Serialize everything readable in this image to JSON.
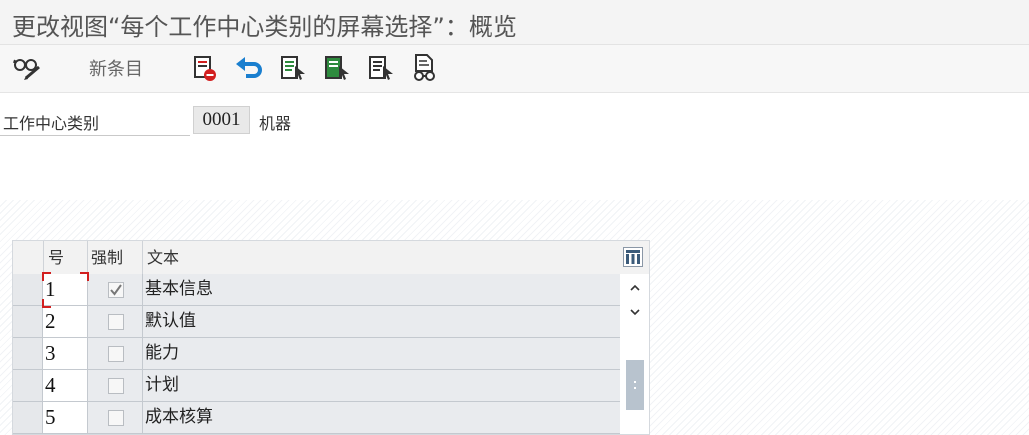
{
  "window": {
    "title": "更改视图“每个工作中心类别的屏幕选择”：概览"
  },
  "toolbar": {
    "display_change_icon": "glasses-pencil-icon",
    "new_entries_label": "新条目",
    "buttons": [
      {
        "name": "delete-row-button",
        "icon": "delete-row-icon"
      },
      {
        "name": "undo-button",
        "icon": "undo-icon"
      },
      {
        "name": "select-all-button",
        "icon": "select-all-icon"
      },
      {
        "name": "select-block-button",
        "icon": "select-block-icon"
      },
      {
        "name": "deselect-all-button",
        "icon": "deselect-all-icon"
      },
      {
        "name": "print-preview-button",
        "icon": "glasses-document-icon"
      }
    ]
  },
  "header_field": {
    "label": "工作中心类别",
    "value": "0001",
    "description": "机器"
  },
  "table": {
    "columns": {
      "number": "号",
      "mandatory": "强制",
      "text": "文本"
    },
    "rows": [
      {
        "number": "1",
        "mandatory": true,
        "text": "基本信息"
      },
      {
        "number": "2",
        "mandatory": false,
        "text": "默认值"
      },
      {
        "number": "3",
        "mandatory": false,
        "text": "能力"
      },
      {
        "number": "4",
        "mandatory": false,
        "text": "计划"
      },
      {
        "number": "5",
        "mandatory": false,
        "text": "成本核算"
      }
    ],
    "focused_row": 1
  },
  "colors": {
    "title_text": "#555555",
    "undo_blue": "#1a7fcf",
    "select_green": "#2e8b3e",
    "delete_red": "#d21f1f",
    "focus_red": "#d21f1f"
  }
}
